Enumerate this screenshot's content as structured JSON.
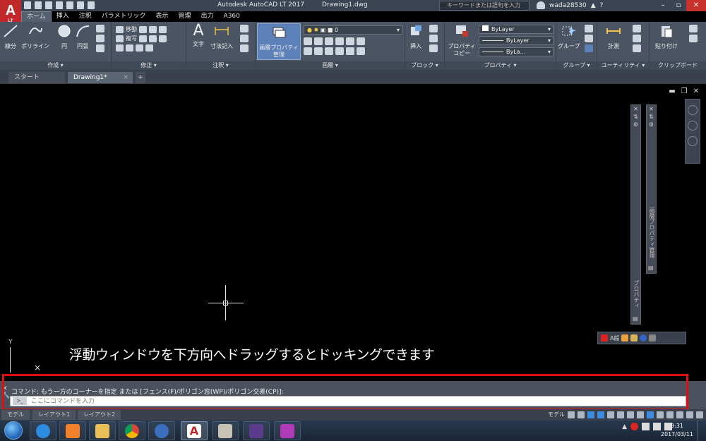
{
  "app": {
    "logo": "A",
    "logo_sub": "LT",
    "product": "Autodesk AutoCAD LT 2017",
    "file": "Drawing1.dwg",
    "search_placeholder": "キーワードまたは語句を入力",
    "user": "wada28530"
  },
  "ribbon_tabs": [
    {
      "label": "ホーム",
      "active": true
    },
    {
      "label": "挿入"
    },
    {
      "label": "注釈"
    },
    {
      "label": "パラメトリック"
    },
    {
      "label": "表示"
    },
    {
      "label": "管理"
    },
    {
      "label": "出力"
    },
    {
      "label": "A360"
    }
  ],
  "panels": {
    "draw": {
      "label": "作成 ▾",
      "line": "線分",
      "polyline": "ポリライン",
      "circle": "円",
      "arc": "円弧"
    },
    "modify": {
      "label": "修正 ▾",
      "move": "移動",
      "copy": "複写"
    },
    "annotation": {
      "label": "注釈 ▾",
      "text": "文字",
      "dimension": "寸法記入"
    },
    "layers": {
      "label": "画層 ▾",
      "layer_properties": "画層プロパティ管理",
      "layer_value": "0"
    },
    "block": {
      "label": "ブロック ▾",
      "insert": "挿入"
    },
    "properties": {
      "label": "プロパティ ▾",
      "match": "プロパティコピー",
      "color": "ByLayer",
      "linetype": "ByLayer",
      "lineweight": "ByLa..."
    },
    "groups": {
      "label": "グループ ▾",
      "group": "グループ"
    },
    "utilities": {
      "label": "ユーティリティ ▾",
      "measure": "計測"
    },
    "clipboard": {
      "label": "クリップボード",
      "paste": "貼り付け"
    }
  },
  "doc_tabs": {
    "start": "スタート",
    "drawing": "Drawing1*",
    "close": "×",
    "add": "+"
  },
  "viewport": {
    "ucs_y": "Y",
    "ucs_x": "×"
  },
  "palettes": {
    "properties_title": "プロパティ",
    "layer_title": "画層プロパティ管理"
  },
  "toolstrip": {
    "text": "A般"
  },
  "annotation_text": "浮動ウィンドウを下方向へドラッグするとドッキングできます",
  "command": {
    "history": "コマンド: もう一方のコーナーを指定 または [フェンス(F)/ポリゴン窓(WP)/ポリゴン交差(CP)]:",
    "placeholder": "ここにコマンドを入力",
    "prefix": ">_"
  },
  "statusbar": {
    "model": "モデル",
    "layout1": "レイアウト1",
    "layout2": "レイアウト2",
    "model_right": "モデル"
  },
  "taskbar": {
    "time": "9:31",
    "date": "2017/03/11"
  },
  "colors": {
    "accent_red": "#e01010",
    "ribbon": "#4a5463",
    "canvas": "#000000"
  }
}
